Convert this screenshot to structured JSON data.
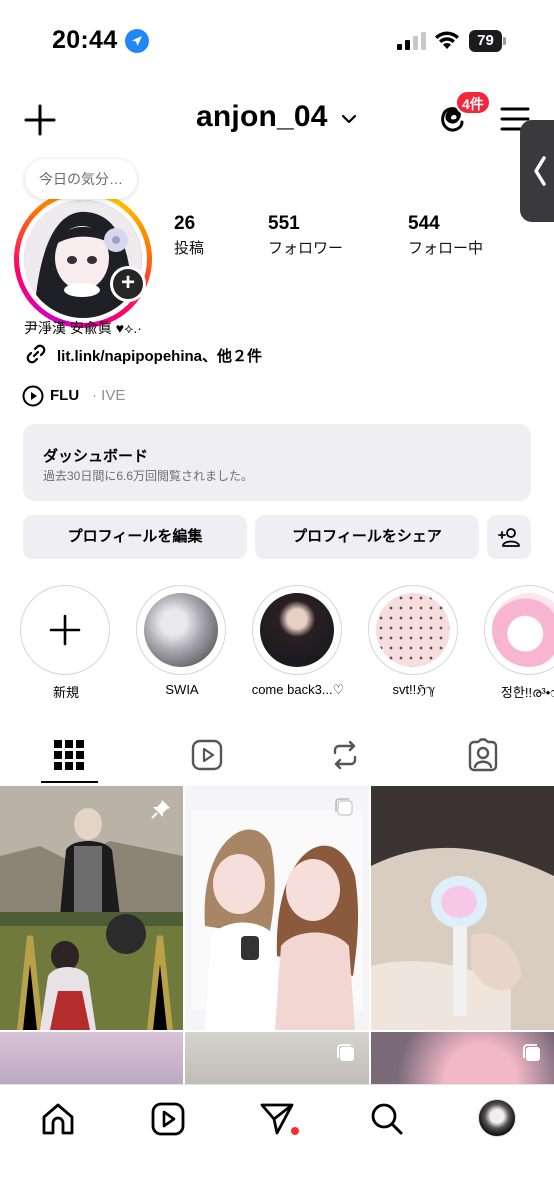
{
  "status_bar": {
    "time": "20:44",
    "battery": "79"
  },
  "header": {
    "username": "anjon_04",
    "threads_badge": "4件"
  },
  "profile": {
    "note": "今日の気分…",
    "stats": [
      {
        "value": "26",
        "label": "投稿"
      },
      {
        "value": "551",
        "label": "フォロワー"
      },
      {
        "value": "544",
        "label": "フォロー中"
      }
    ],
    "bio_name": "尹淨漢 安兪眞 ♥⟡.·",
    "link": "lit.link/napipopehina、他２件",
    "music_title": "FLU",
    "music_artist": "· IVE"
  },
  "dashboard": {
    "title": "ダッシュボード",
    "subtitle": "過去30日間に6.6万回閲覧されました。"
  },
  "buttons": {
    "edit_profile": "プロフィールを編集",
    "share_profile": "プロフィールをシェア"
  },
  "highlights": [
    {
      "label": "新規"
    },
    {
      "label": "SWIA"
    },
    {
      "label": "come back3...♡"
    },
    {
      "label": "svt!!ℌ︎ℽ︎"
    },
    {
      "label": "정한!!ര³•ෆ"
    }
  ],
  "tabs": [
    "grid-icon",
    "reels-icon",
    "reposts-icon",
    "tagged-icon"
  ],
  "colors": {
    "accent_red": "#f0273d",
    "button_bg": "#efeff3",
    "location_blue": "#1e88f5"
  }
}
